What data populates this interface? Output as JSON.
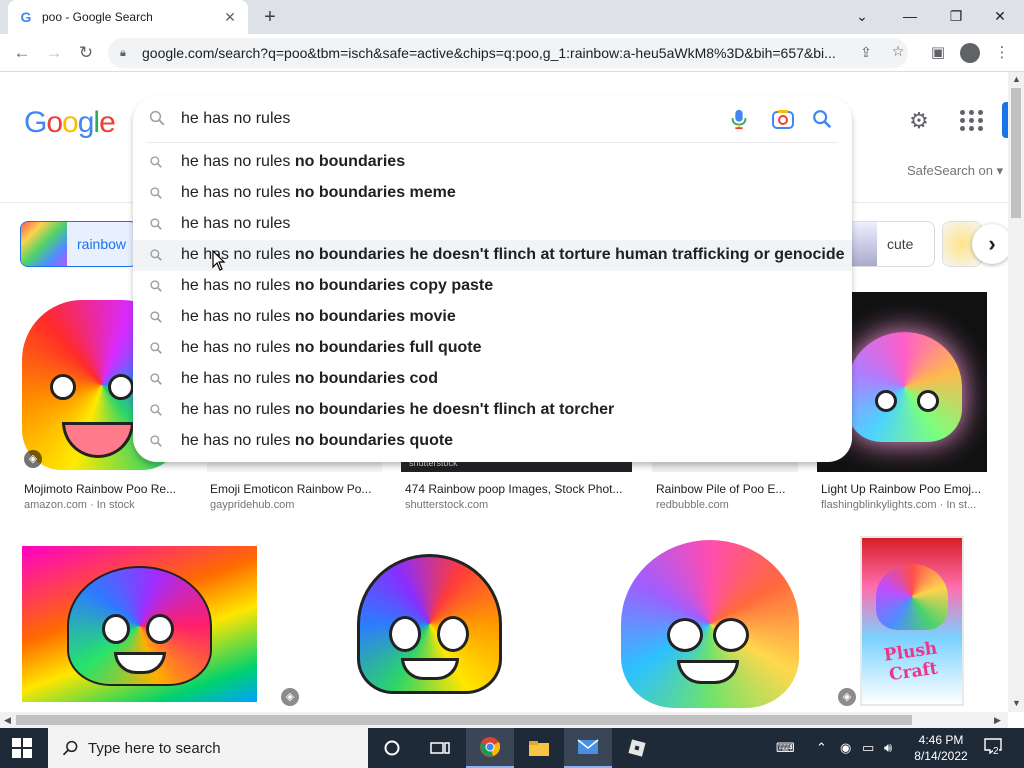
{
  "browser": {
    "tab": {
      "title": "poo - Google Search",
      "favicon": "G"
    },
    "newtab_label": "+",
    "window_controls": {
      "collapse": "⌄",
      "minimize": "—",
      "restore": "❐",
      "close": "✕"
    },
    "url": "google.com/search?q=poo&tbm=isch&safe=active&chips=q:poo,g_1:rainbow:a-heu5aWkM8%3D&bih=657&bi..."
  },
  "header": {
    "logo_letters": [
      {
        "ch": "G",
        "color": "#4285f4"
      },
      {
        "ch": "o",
        "color": "#ea4335"
      },
      {
        "ch": "o",
        "color": "#fbbc05"
      },
      {
        "ch": "g",
        "color": "#4285f4"
      },
      {
        "ch": "l",
        "color": "#34a853"
      },
      {
        "ch": "e",
        "color": "#ea4335"
      }
    ],
    "safesearch": "SafeSearch on ▾"
  },
  "search": {
    "query": "he has no rules",
    "suggestions": [
      {
        "prefix": "he has no rules ",
        "bold": "no boundaries"
      },
      {
        "prefix": "he has no rules ",
        "bold": "no boundaries meme"
      },
      {
        "prefix": "he has no rules",
        "bold": ""
      },
      {
        "prefix": "he has no rules ",
        "bold": "no boundaries he doesn't flinch at torture human trafficking or genocide"
      },
      {
        "prefix": "he has no rules ",
        "bold": "no boundaries copy paste"
      },
      {
        "prefix": "he has no rules ",
        "bold": "no boundaries movie"
      },
      {
        "prefix": "he has no rules ",
        "bold": "no boundaries full quote"
      },
      {
        "prefix": "he has no rules ",
        "bold": "no boundaries cod"
      },
      {
        "prefix": "he has no rules ",
        "bold": "no boundaries he doesn't flinch at torcher"
      },
      {
        "prefix": "he has no rules ",
        "bold": "no boundaries quote"
      }
    ],
    "hovered_index": 3
  },
  "chips": {
    "active": "rainbow",
    "cute": "cute"
  },
  "results_row1": [
    {
      "title": "Mojimoto Rainbow Poo Re...",
      "source": "amazon.com · In stock"
    },
    {
      "title": "Emoji Emoticon Rainbow Po...",
      "source": "gaypridehub.com"
    },
    {
      "title": "474 Rainbow poop Images, Stock Phot...",
      "source": "shutterstock.com",
      "watermark": "shutterstock"
    },
    {
      "title": "Rainbow Pile of Poo E...",
      "source": "redbubble.com"
    },
    {
      "title": "Light Up Rainbow Poo Emoj...",
      "source": "flashingblinkylights.com · In st..."
    }
  ],
  "plush_box": {
    "brand": "Plush Craft"
  },
  "taskbar": {
    "search_placeholder": "Type here to search",
    "time": "4:46 PM",
    "date": "8/14/2022",
    "notifications": "2"
  }
}
